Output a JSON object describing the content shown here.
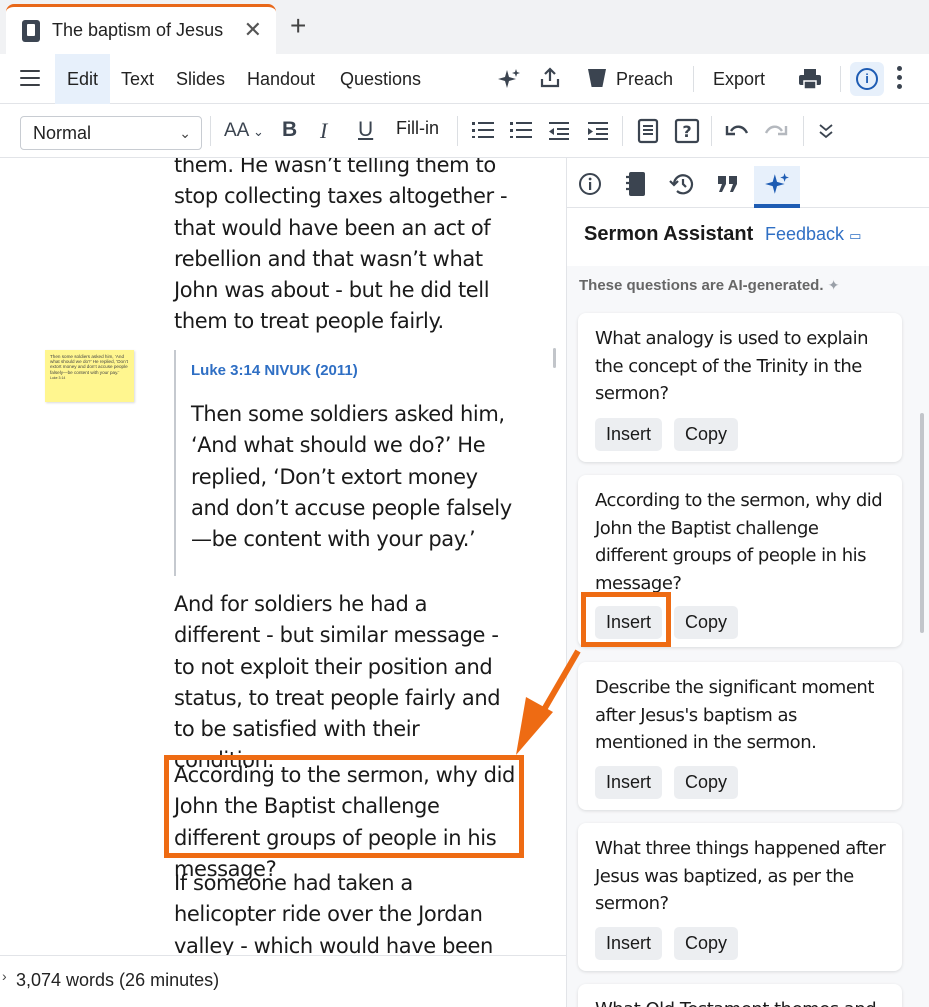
{
  "tabbar": {
    "tab_title": "The baptism of Jesus",
    "close_glyph": "✕",
    "new_tab_glyph": "+"
  },
  "menubar": {
    "items": [
      "Edit",
      "Text",
      "Slides",
      "Handout",
      "Questions"
    ],
    "active_item": "Edit",
    "preach_label": "Preach",
    "export_label": "Export",
    "icons": [
      "menu-icon",
      "sparkle-icon",
      "share-icon",
      "pulpit-icon",
      "print-icon",
      "info-icon",
      "more-vert-icon"
    ]
  },
  "format_toolbar": {
    "style_value": "Normal",
    "bold": "B",
    "italic": "I",
    "underline": "U",
    "font_size_glyph": "AA",
    "fill_in_label": "Fill-in",
    "icons": [
      "font-size-icon",
      "bullet-list-icon",
      "numbered-list-icon",
      "outdent-icon",
      "indent-icon",
      "slide-icon",
      "question-icon",
      "undo-icon",
      "redo-icon",
      "expand-icon"
    ]
  },
  "editor": {
    "para1": "them. He wasn’t telling them to stop collecting taxes altogether - that would have been an act of rebellion and that wasn’t what John was about - but he did tell them to treat people fairly.",
    "sticky_note": "Then some soldiers asked him, ‘And what should we do?’ He replied, ‘Don’t extort money and don’t accuse people falsely—be content with your pay.’",
    "sticky_ref": "Luke 3:14",
    "quote_ref": "Luke 3:14 NIVUK (2011)",
    "quote_text": "Then some soldiers asked him, ‘And what should we do?’ He replied, ‘Don’t extort money and don’t accuse people falsely—be content with your pay.’",
    "para2": "And for soldiers he had a different - but similar message - to not exploit their position and status, to treat people fairly and to be satisfied with their condition.",
    "para3": "According to the sermon, why did John the Baptist challenge different groups of people in his message?",
    "para4": "If someone had taken a helicopter ride over the Jordan valley - which would have been difficult two"
  },
  "statusbar": {
    "word_count": "3,074 words (26 minutes)"
  },
  "panel": {
    "title": "Sermon Assistant",
    "feedback_label": "Feedback",
    "ai_note": "These questions are AI-generated.",
    "tab_icons": [
      "info-icon",
      "notebook-icon",
      "history-icon",
      "quote-icon",
      "sparkle-icon"
    ],
    "active_tab": "sparkle-icon",
    "insert_label": "Insert",
    "copy_label": "Copy",
    "questions": [
      "What analogy is used to explain the concept of the Trinity in the sermon?",
      "According to the sermon, why did John the Baptist challenge different groups of people in his message?",
      "Describe the significant moment after Jesus's baptism as mentioned in the sermon.",
      "What three things happened after Jesus was baptized, as per the sermon?",
      "What Old Testament themes and"
    ]
  },
  "colors": {
    "accent_orange": "#ee6b13",
    "link_blue": "#2f6fc4",
    "active_blue": "#1e5cb3"
  }
}
